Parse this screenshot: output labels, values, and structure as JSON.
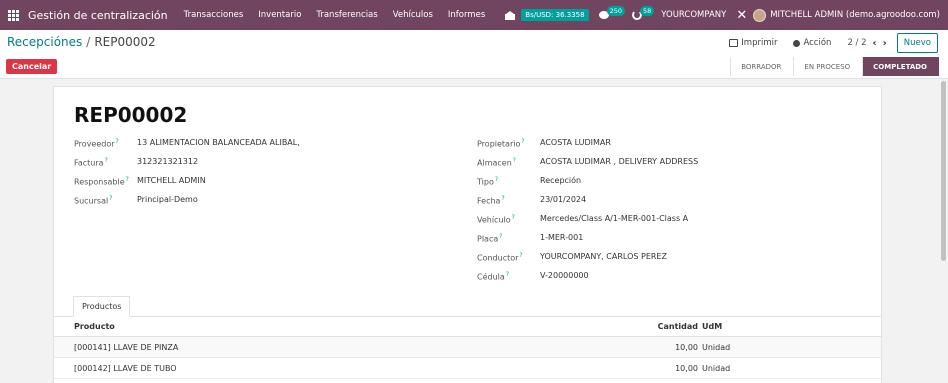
{
  "navbar": {
    "brand": "Gestión de centralización",
    "menus": [
      "Transacciones",
      "Inventario",
      "Transferencias",
      "Vehículos",
      "Informes"
    ],
    "rate_label": "Bs/USD: 36.3358",
    "messages_count": "250",
    "activities_count": "58",
    "company": "YOURCOMPANY",
    "user": "MITCHELL ADMIN (demo.agroodoo.com)"
  },
  "breadcrumb": {
    "parent": "Recepciónes",
    "separator": "/",
    "current": "REP00002"
  },
  "actions": {
    "print_label": "Imprimir",
    "action_label": "Acción",
    "pager": "2 / 2",
    "prev_label": "‹",
    "next_label": "›",
    "new_label": "Nuevo",
    "cancel_label": "Cancelar"
  },
  "statusbar": [
    "BORRADOR",
    "EN PROCESO",
    "COMPLETADO"
  ],
  "statusbar_active": "COMPLETADO",
  "record": {
    "title": "REP00002",
    "left_fields": [
      {
        "label": "Proveedor",
        "value": "13 ALIMENTACION BALANCEADA ALIBAL,"
      },
      {
        "label": "Factura",
        "value": "312321321312"
      },
      {
        "label": "Responsable",
        "value": "MITCHELL ADMIN"
      },
      {
        "label": "Sucursal",
        "value": "Principal-Demo"
      }
    ],
    "right_fields": [
      {
        "label": "Propietario",
        "value": "ACOSTA LUDIMAR"
      },
      {
        "label": "Almacen",
        "value": "ACOSTA LUDIMAR , DELIVERY ADDRESS"
      },
      {
        "label": "Tipo",
        "value": "Recepción"
      },
      {
        "label": "Fecha",
        "value": "23/01/2024"
      },
      {
        "label": "Vehículo",
        "value": "Mercedes/Class A/1-MER-001-Class A"
      },
      {
        "label": "Placa",
        "value": "1-MER-001"
      },
      {
        "label": "Conductor",
        "value": "YOURCOMPANY, CARLOS PEREZ"
      },
      {
        "label": "Cédula",
        "value": "V-20000000"
      }
    ],
    "help_mark": "?"
  },
  "tab": {
    "label": "Productos"
  },
  "table": {
    "headers": {
      "product": "Producto",
      "quantity": "Cantidad",
      "uom": "UdM"
    },
    "rows": [
      {
        "product": "[000141] LLAVE DE PINZA",
        "quantity": "10,00",
        "uom": "Unidad"
      },
      {
        "product": "[000142] LLAVE DE TUBO",
        "quantity": "10,00",
        "uom": "Unidad"
      }
    ]
  },
  "colors": {
    "navbar": "#71455f",
    "accent": "#017e84",
    "badge": "#00a09d",
    "cancel": "#dc3545"
  }
}
